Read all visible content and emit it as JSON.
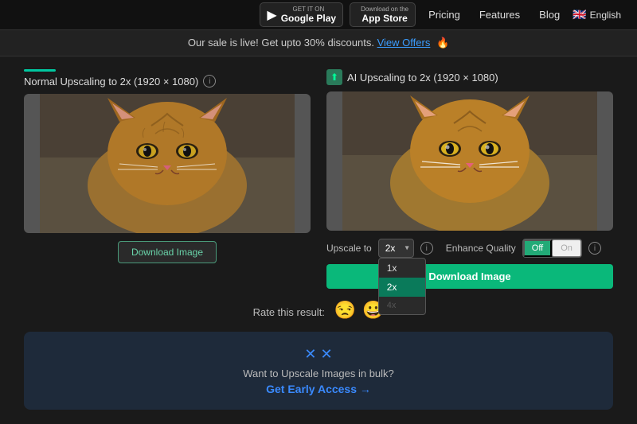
{
  "navbar": {
    "google_play": {
      "sub": "GET IT ON",
      "main": "Google Play"
    },
    "app_store": {
      "sub": "Download on the",
      "main": "App Store"
    },
    "links": [
      "Pricing",
      "Features",
      "Blog"
    ],
    "lang": "English"
  },
  "sale_banner": {
    "text": "Our sale is live! Get upto 30% discounts.",
    "cta": "View Offers",
    "emoji": "🔥"
  },
  "left_panel": {
    "title": "Normal Upscaling to 2x (1920 × 1080)",
    "download_label": "Download Image"
  },
  "right_panel": {
    "title": "AI Upscaling to 2x (1920 × 1080)",
    "upscale_label": "Upscale to",
    "upscale_value": "2x",
    "upscale_options": [
      "1x",
      "2x",
      "4x"
    ],
    "enhance_label": "Enhance Quality",
    "toggle_off": "Off",
    "toggle_on": "On",
    "download_label": "Download Image"
  },
  "rating": {
    "label": "Rate this result:",
    "sad_emoji": "😒",
    "happy_emoji": "😀"
  },
  "bulk_banner": {
    "icon": "✕",
    "text": "Want to Upscale Images in bulk?",
    "cta": "Get Early Access →"
  },
  "dropdown": {
    "visible": true,
    "items": [
      "1x",
      "2x",
      "4x"
    ],
    "selected": "2x"
  }
}
